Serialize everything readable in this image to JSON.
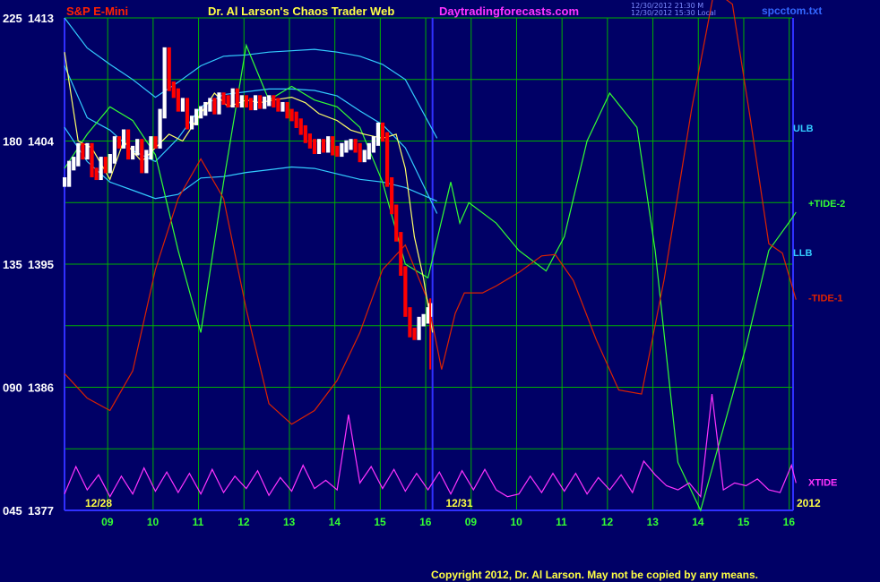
{
  "header": {
    "symbol": "S&P E-Mini",
    "title": "Dr. Al Larson's Chaos Trader Web",
    "site": "Daytradingforecasts.com",
    "stamp_line1": "12/30/2012 21:30 M",
    "stamp_line2": "12/30/2012 15:30 Local",
    "file": "spcctom.txt"
  },
  "footer": {
    "copyright": "Copyright 2012, Dr. Al Larson. May not be copied by any means."
  },
  "colors": {
    "background": "#000066",
    "grid": "#00b000",
    "axis": "#3030ff",
    "price_up": "#ffffff",
    "price_down": "#ff0000",
    "ulb_llb": "#33ccff",
    "tide2": "#33ff33",
    "tide1": "#dd2200",
    "xtide": "#ff33ff",
    "avg": "#ffff66"
  },
  "chart_data": {
    "type": "line",
    "title": "S&P E-Mini",
    "x_tick_labels": [
      "09",
      "10",
      "11",
      "12",
      "13",
      "14",
      "15",
      "16",
      "09",
      "10",
      "11",
      "12",
      "13",
      "14",
      "15",
      "16"
    ],
    "date_labels": [
      "12/28",
      "12/31"
    ],
    "year_label": "2012",
    "y_tick_labels": [
      {
        "left": "225",
        "price": "1413"
      },
      {
        "left": "180",
        "price": "1404"
      },
      {
        "left": "135",
        "price": "1395"
      },
      {
        "left": "090",
        "price": "1386"
      },
      {
        "left": "045",
        "price": "1377"
      }
    ],
    "ylim": [
      1377,
      1413
    ],
    "right_labels": [
      "ULB",
      "+TIDE-2",
      "LLB",
      "-TIDE-1",
      "XTIDE"
    ],
    "series": [
      {
        "name": "ULB",
        "x": [
          0,
          0.5,
          1,
          1.5,
          2,
          2.5,
          3,
          3.5,
          4,
          4.5,
          5,
          5.5,
          6,
          6.5,
          7,
          7.5,
          8.2
        ],
        "y": [
          1413,
          1410.8,
          1409.6,
          1408.5,
          1407.2,
          1408.3,
          1409.5,
          1410.2,
          1410.3,
          1410.5,
          1410.6,
          1410.7,
          1410.5,
          1410.2,
          1409.6,
          1408.5,
          1404.2
        ]
      },
      {
        "name": "band_middle",
        "x": [
          0,
          0.5,
          1,
          1.5,
          2,
          2.5,
          3,
          3.5,
          4,
          4.5,
          5,
          5.5,
          6,
          6.5,
          7,
          7.5,
          8.2
        ],
        "y": [
          1409.5,
          1405.7,
          1404.8,
          1403.3,
          1402.5,
          1404.2,
          1406.5,
          1407.4,
          1407.6,
          1407.8,
          1407.8,
          1407.7,
          1407.3,
          1406.2,
          1405.2,
          1403.5,
          1398.7
        ]
      },
      {
        "name": "LLB",
        "x": [
          0,
          0.5,
          1,
          1.5,
          2,
          2.5,
          3,
          3.5,
          4,
          4.5,
          5,
          5.5,
          6,
          6.5,
          7,
          7.5,
          8.2
        ],
        "y": [
          1405,
          1402.5,
          1401,
          1400.4,
          1399.8,
          1400.1,
          1401.3,
          1401.4,
          1401.7,
          1401.9,
          1402.1,
          1402,
          1401.6,
          1401.2,
          1401,
          1400.6,
          1399.6
        ]
      },
      {
        "name": "+TIDE-2",
        "x": [
          0,
          0.5,
          1,
          1.5,
          2,
          2.5,
          3,
          3.5,
          4,
          4.5,
          5,
          5.5,
          6,
          6.5,
          7,
          7.5,
          8,
          8.5,
          8.7,
          8.9,
          9.5,
          10,
          10.6,
          11,
          11.5,
          12,
          12.6,
          13,
          13.5,
          14,
          14.5,
          15,
          15.5,
          16,
          16.1
        ],
        "y": [
          1402,
          1404.5,
          1406.5,
          1405.5,
          1403,
          1396,
          1390,
          1401,
          1411,
          1407,
          1408,
          1407,
          1406.5,
          1405,
          1401,
          1395,
          1394,
          1401,
          1398,
          1399.5,
          1398,
          1396,
          1394.5,
          1397,
          1404,
          1407.5,
          1405,
          1396,
          1380.5,
          1377,
          1383,
          1389,
          1396,
          1398.3,
          1398.8
        ]
      },
      {
        "name": "-TIDE-1",
        "x": [
          0,
          0.5,
          1,
          1.5,
          2,
          2.5,
          3,
          3.5,
          4,
          4.5,
          5,
          5.5,
          6,
          6.5,
          7,
          7.5,
          8,
          8.3,
          8.6,
          8.8,
          9.2,
          9.5,
          10,
          10.5,
          10.8,
          11.2,
          11.7,
          12.2,
          12.7,
          13.2,
          13.8,
          14.3,
          14.7,
          15.1,
          15.5,
          15.8,
          16.1
        ],
        "y": [
          1387,
          1385.2,
          1384.3,
          1387.2,
          1394.6,
          1399.8,
          1402.7,
          1399.8,
          1391.7,
          1384.8,
          1383.3,
          1384.3,
          1386.5,
          1390,
          1394.6,
          1396.4,
          1392.3,
          1387.3,
          1391.4,
          1392.9,
          1392.9,
          1393.4,
          1394.4,
          1395.6,
          1395.7,
          1393.8,
          1389.5,
          1385.8,
          1385.5,
          1393.9,
          1406.3,
          1415,
          1414,
          1405.5,
          1396.5,
          1395.8,
          1392.4
        ]
      },
      {
        "name": "XTIDE",
        "x": [
          0,
          0.25,
          0.5,
          0.75,
          1,
          1.25,
          1.5,
          1.75,
          2,
          2.25,
          2.5,
          2.75,
          3,
          3.25,
          3.5,
          3.75,
          4,
          4.25,
          4.5,
          4.75,
          5,
          5.25,
          5.5,
          5.75,
          6,
          6.25,
          6.5,
          6.75,
          7,
          7.25,
          7.5,
          7.75,
          8,
          8.25,
          8.5,
          8.75,
          9,
          9.25,
          9.5,
          9.75,
          10,
          10.25,
          10.5,
          10.75,
          11,
          11.25,
          11.5,
          11.75,
          12,
          12.25,
          12.5,
          12.75,
          13,
          13.25,
          13.5,
          13.75,
          14,
          14.25,
          14.5,
          14.75,
          15,
          15.25,
          15.5,
          15.75,
          16,
          16.1
        ],
        "y": [
          1378.2,
          1380.2,
          1378.5,
          1379.6,
          1378,
          1379.5,
          1378.2,
          1380.1,
          1378.4,
          1379.8,
          1378.3,
          1379.7,
          1378.2,
          1380,
          1378.3,
          1379.5,
          1378.6,
          1379.9,
          1378.1,
          1379.4,
          1378.4,
          1380.3,
          1378.6,
          1379.2,
          1378.5,
          1384,
          1379,
          1380.2,
          1378.6,
          1380,
          1378.4,
          1379.7,
          1378.5,
          1379.8,
          1378.2,
          1379.9,
          1378.5,
          1380,
          1378.5,
          1378,
          1378.2,
          1379.5,
          1378.3,
          1379.7,
          1378.4,
          1379.7,
          1378.2,
          1379.4,
          1378.5,
          1379.6,
          1378.3,
          1380.6,
          1379.6,
          1378.8,
          1378.5,
          1379,
          1378,
          1385.5,
          1378.5,
          1379,
          1378.8,
          1379.3,
          1378.5,
          1378.3,
          1380.3,
          1379
        ]
      },
      {
        "name": "average",
        "x": [
          0,
          0.3,
          0.6,
          1,
          1.3,
          1.7,
          2,
          2.3,
          2.6,
          3,
          3.3,
          3.6,
          4,
          4.3,
          4.6,
          5,
          5.3,
          5.6,
          6,
          6.3,
          6.6,
          7,
          7.3,
          7.5,
          7.7,
          7.9,
          8.1
        ],
        "y": [
          1410.5,
          1404,
          1403.5,
          1401.2,
          1404,
          1402.5,
          1403.5,
          1404.5,
          1404,
          1406,
          1407.5,
          1406.5,
          1407,
          1406.8,
          1407,
          1407.2,
          1406.8,
          1406,
          1405.5,
          1404.8,
          1404.5,
          1404.2,
          1404.5,
          1402,
          1397,
          1394,
          1390
        ]
      },
      {
        "name": "price",
        "x": [
          0,
          0.1,
          0.2,
          0.3,
          0.4,
          0.5,
          0.6,
          0.7,
          0.8,
          0.9,
          1,
          1.1,
          1.2,
          1.3,
          1.4,
          1.5,
          1.6,
          1.7,
          1.8,
          1.9,
          2,
          2.1,
          2.2,
          2.3,
          2.4,
          2.5,
          2.6,
          2.7,
          2.8,
          2.9,
          3,
          3.1,
          3.2,
          3.3,
          3.4,
          3.5,
          3.6,
          3.7,
          3.8,
          3.9,
          4,
          4.1,
          4.2,
          4.3,
          4.4,
          4.5,
          4.6,
          4.7,
          4.8,
          4.9,
          5,
          5.1,
          5.2,
          5.3,
          5.4,
          5.5,
          5.6,
          5.7,
          5.8,
          5.9,
          6,
          6.1,
          6.2,
          6.3,
          6.4,
          6.5,
          6.6,
          6.7,
          6.8,
          6.9,
          7,
          7.1,
          7.2,
          7.3,
          7.4,
          7.5,
          7.6,
          7.7,
          7.8,
          7.9,
          8,
          8.05
        ],
        "y": [
          1401,
          1402.2,
          1402.5,
          1403.5,
          1403,
          1403.5,
          1401.7,
          1401.5,
          1402.5,
          1402,
          1402.7,
          1404,
          1403.8,
          1404.5,
          1403,
          1403.3,
          1403.8,
          1402,
          1403,
          1404,
          1403.8,
          1406,
          1410.5,
          1408,
          1407.5,
          1406.5,
          1406.8,
          1405.2,
          1405.5,
          1406,
          1406.2,
          1406.5,
          1406.8,
          1406.3,
          1407.2,
          1407,
          1406.8,
          1407.5,
          1406.8,
          1407,
          1406.8,
          1406.6,
          1407,
          1406.7,
          1406.9,
          1407,
          1406.8,
          1406.5,
          1406.5,
          1406,
          1405.8,
          1405.3,
          1404.8,
          1404.2,
          1403.8,
          1403.4,
          1403.8,
          1403.5,
          1404,
          1403.3,
          1403.2,
          1403.5,
          1403.7,
          1403.8,
          1403.5,
          1402.8,
          1403,
          1403.5,
          1404,
          1405,
          1404.3,
          1401,
          1399,
          1397,
          1394.5,
          1391.5,
          1390,
          1389.8,
          1390.8,
          1391,
          1391.5,
          1391.8
        ]
      }
    ]
  }
}
